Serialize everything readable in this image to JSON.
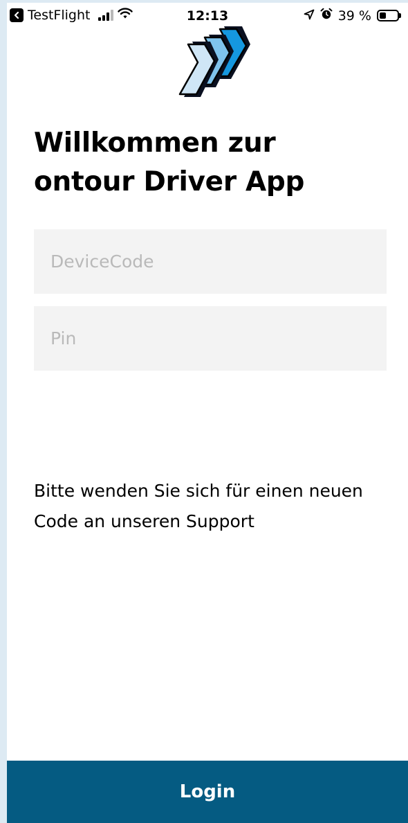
{
  "status_bar": {
    "back_app": "TestFlight",
    "time": "12:13",
    "battery": "39 %",
    "battery_level": 0.39,
    "icons": [
      "back-arrow-icon",
      "cellular-signal-icon",
      "wifi-icon",
      "location-arrow-icon",
      "alarm-icon",
      "battery-icon"
    ]
  },
  "logo": {
    "icon": "chevron-arrows-logo",
    "colors": {
      "light_blue": "#cfe6f6",
      "mid_blue": "#7fc3ec",
      "bright_blue": "#1597df",
      "outline": "#000000"
    }
  },
  "header": {
    "title_line1": "Willkommen zur",
    "title_line2": "ontour Driver App"
  },
  "form": {
    "device_code_placeholder": "DeviceCode",
    "device_code_value": "",
    "pin_placeholder": "Pin",
    "pin_value": ""
  },
  "info": {
    "support_text": "Bitte wenden Sie sich für einen neuen Code an unseren Support"
  },
  "footer": {
    "login_label": "Login"
  },
  "colors": {
    "primary": "#055b82",
    "input_background": "#f3f3f3",
    "placeholder": "#b9b9b9",
    "background": "#ffffff"
  }
}
